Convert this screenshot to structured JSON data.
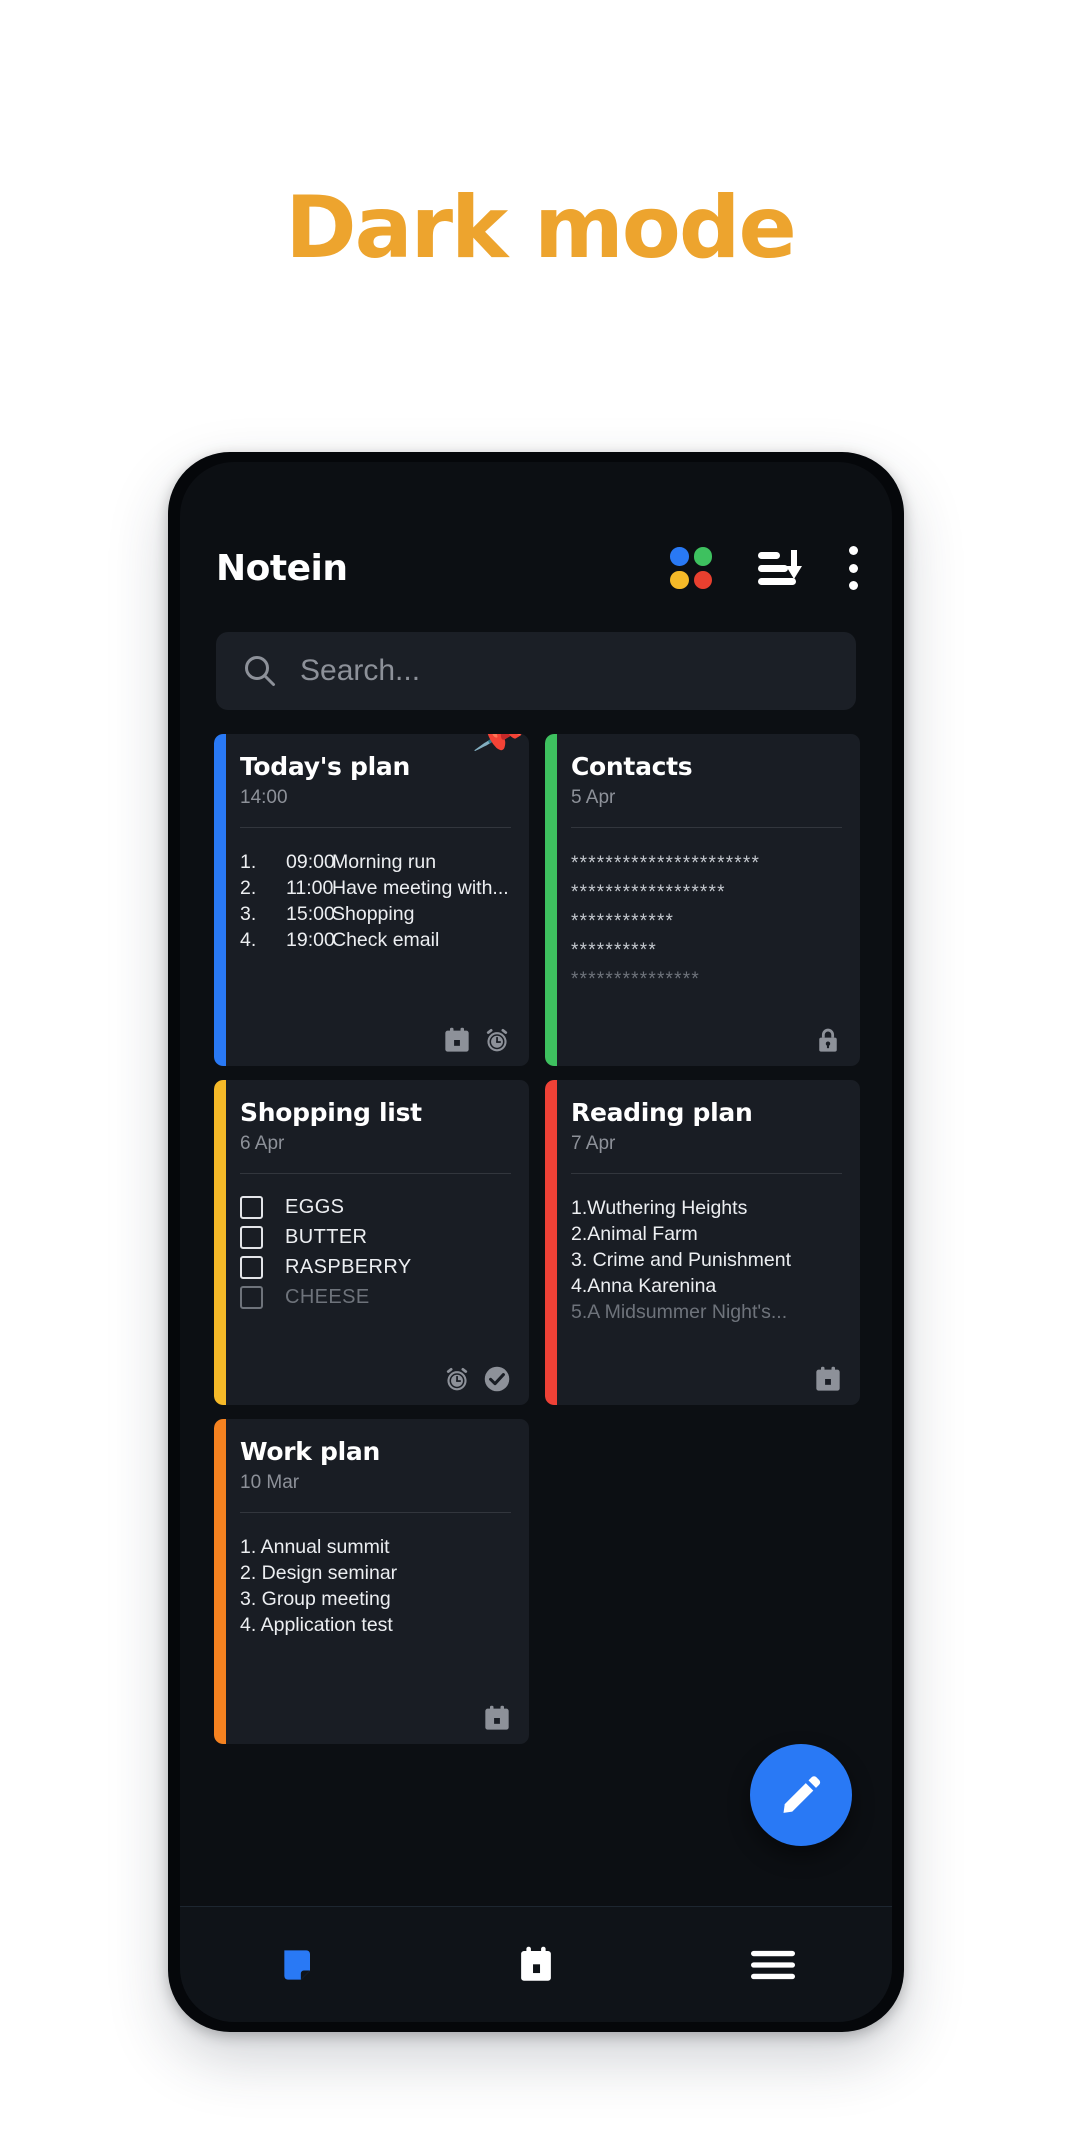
{
  "headline": "Dark mode",
  "theme": {
    "page_background": "#ffffff",
    "headline_color": "#eda42e",
    "screen_background": "#0c0f13",
    "card_background": "#191d24",
    "accent_blue": "#2979f5",
    "text_primary": "#ffffff",
    "text_secondary": "#8d9199"
  },
  "app": {
    "title": "Notein",
    "toolbar": [
      {
        "name": "color-palette-icon",
        "label": "Colors",
        "dots": [
          "#2979f5",
          "#3ec15f",
          "#f5b928",
          "#e8402f"
        ]
      },
      {
        "name": "sort-icon",
        "label": "Sort"
      },
      {
        "name": "overflow-menu-icon",
        "label": "More options"
      }
    ],
    "search": {
      "placeholder": "Search...",
      "value": "",
      "icon": "search-icon"
    },
    "fab": {
      "icon": "pencil-icon",
      "label": "New note",
      "color": "#2979f5"
    },
    "bottom_nav": [
      {
        "name": "nav-notes",
        "icon": "note-icon",
        "label": "Notes",
        "active": true,
        "color": "#2979f5"
      },
      {
        "name": "nav-calendar",
        "icon": "calendar-icon",
        "label": "Calendar",
        "active": false,
        "color": "#ffffff"
      },
      {
        "name": "nav-menu",
        "icon": "hamburger-icon",
        "label": "Menu",
        "active": false,
        "color": "#ffffff"
      }
    ]
  },
  "notes": [
    {
      "id": "todays-plan",
      "title": "Today's plan",
      "date": "14:00",
      "stripe_color": "#2979f5",
      "pinned": true,
      "pin_icon": "pushpin-icon",
      "body_type": "numbered-time",
      "lines": [
        {
          "n": "1.",
          "time": "09:00",
          "text": "Morning run",
          "dim": false
        },
        {
          "n": "2.",
          "time": "11:00",
          "text": "Have meeting with...",
          "dim": false
        },
        {
          "n": "3.",
          "time": "15:00",
          "text": "Shopping",
          "dim": false
        },
        {
          "n": "4.",
          "time": "19:00",
          "text": "Check email",
          "dim": false
        }
      ],
      "footer_icons": [
        "calendar-icon",
        "alarm-icon"
      ]
    },
    {
      "id": "contacts",
      "title": "Contacts",
      "date": "5 Apr",
      "stripe_color": "#3ec15f",
      "pinned": false,
      "body_type": "masked",
      "lines": [
        {
          "text": "**********************",
          "dim": false
        },
        {
          "text": "******************",
          "dim": false
        },
        {
          "text": "************",
          "dim": false
        },
        {
          "text": "**********",
          "dim": false
        },
        {
          "text": "***************",
          "dim": true
        }
      ],
      "footer_icons": [
        "lock-icon"
      ]
    },
    {
      "id": "shopping-list",
      "title": "Shopping list",
      "date": "6 Apr",
      "stripe_color": "#f5b928",
      "pinned": false,
      "body_type": "checklist",
      "lines": [
        {
          "text": "EGGS",
          "checked": false,
          "dim": false
        },
        {
          "text": "BUTTER",
          "checked": false,
          "dim": false
        },
        {
          "text": "RASPBERRY",
          "checked": false,
          "dim": false
        },
        {
          "text": "CHEESE",
          "checked": false,
          "dim": true
        }
      ],
      "footer_icons": [
        "alarm-icon",
        "check-circle-icon"
      ]
    },
    {
      "id": "reading-plan",
      "title": "Reading plan",
      "date": "7 Apr",
      "stripe_color": "#ef4136",
      "pinned": false,
      "body_type": "numbered",
      "lines": [
        {
          "text": "1.Wuthering Heights",
          "dim": false
        },
        {
          "text": "2.Animal Farm",
          "dim": false
        },
        {
          "text": "3. Crime and Punishment",
          "dim": false
        },
        {
          "text": "4.Anna Karenina",
          "dim": false
        },
        {
          "text": "5.A Midsummer Night's...",
          "dim": true
        }
      ],
      "footer_icons": [
        "calendar-icon"
      ]
    },
    {
      "id": "work-plan",
      "title": "Work plan",
      "date": "10 Mar",
      "stripe_color": "#f58220",
      "pinned": false,
      "body_type": "numbered",
      "lines": [
        {
          "text": "1. Annual summit",
          "dim": false
        },
        {
          "text": "2. Design seminar",
          "dim": false
        },
        {
          "text": "3. Group meeting",
          "dim": false
        },
        {
          "text": "4. Application test",
          "dim": false
        }
      ],
      "footer_icons": [
        "calendar-icon"
      ]
    }
  ]
}
